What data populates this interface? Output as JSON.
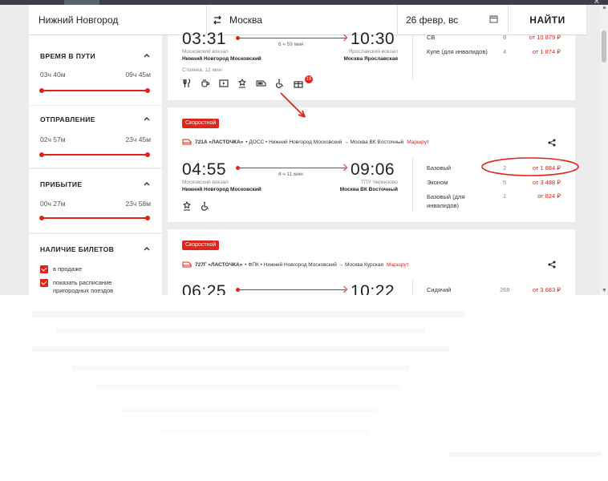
{
  "search": {
    "from": "Нижний Новгород",
    "to": "Москва",
    "date": "26 февр, вс",
    "find_label": "НАЙТИ"
  },
  "sidebar": {
    "travel_time": {
      "title": "ВРЕМЯ В ПУТИ",
      "min": "03ч 40м",
      "max": "09ч 45м"
    },
    "departure": {
      "title": "ОТПРАВЛЕНИЕ",
      "min": "02ч 57м",
      "max": "23ч 45м"
    },
    "arrival": {
      "title": "ПРИБЫТИЕ",
      "min": "00ч 27м",
      "max": "23ч 58м"
    },
    "tickets": {
      "title": "НАЛИЧИЕ БИЛЕТОВ",
      "options": [
        {
          "label": "в продаже",
          "checked": true
        },
        {
          "label": "показать расписание пригородных поездов",
          "checked": true
        }
      ]
    }
  },
  "trains": [
    {
      "dep_time": "03:31",
      "arr_time": "10:30",
      "duration": "6 ч 59 мин",
      "dep_station": "Московский вокзал",
      "dep_city": "Нижний Новгород Московский",
      "arr_station": "Ярославский вокзал",
      "arr_city": "Москва Ярославская",
      "delay": "Стоянка: 12 мин",
      "notification_count": "18",
      "classes": [
        {
          "name": "СВ",
          "count": "8",
          "price": "от 10 879 ₽"
        },
        {
          "name": "Купе (для инвалидов)",
          "count": "4",
          "price": "от 1 874 ₽"
        }
      ]
    },
    {
      "badge": "Скоростной",
      "number": "721А «ЛАСТОЧКА»",
      "route_text": "• ДОСС • Нижний Новгород Московский → Москва ВК Восточный",
      "route_link": "Маршрут",
      "dep_time": "04:55",
      "arr_time": "09:06",
      "duration": "4 ч 11 мин",
      "dep_station": "Московский вокзал",
      "dep_city": "Нижний Новгород Московский",
      "arr_station": "ТПУ Черкизово",
      "arr_city": "Москва ВК Восточный",
      "classes": [
        {
          "name": "Базовый",
          "count": "2",
          "price": "от 1 884 ₽"
        },
        {
          "name": "Эконом",
          "count": "5",
          "price": "от 3 488 ₽"
        },
        {
          "name": "Базовый (для инвалидов)",
          "count": "1",
          "price": "от 824 ₽"
        }
      ]
    },
    {
      "badge": "Скоростной",
      "number": "727Г «ЛАСТОЧКА»",
      "route_text": "• ФПК • Нижний Новгород Московский → Москва Курская",
      "route_link": "Маршрут",
      "dep_time": "06:25",
      "arr_time": "10:22",
      "classes": [
        {
          "name": "Сидячий",
          "count": "268",
          "price": "от 3 683 ₽"
        }
      ]
    }
  ],
  "colors": {
    "accent": "#e2231a",
    "background": "#ececec",
    "card": "#ffffff"
  }
}
